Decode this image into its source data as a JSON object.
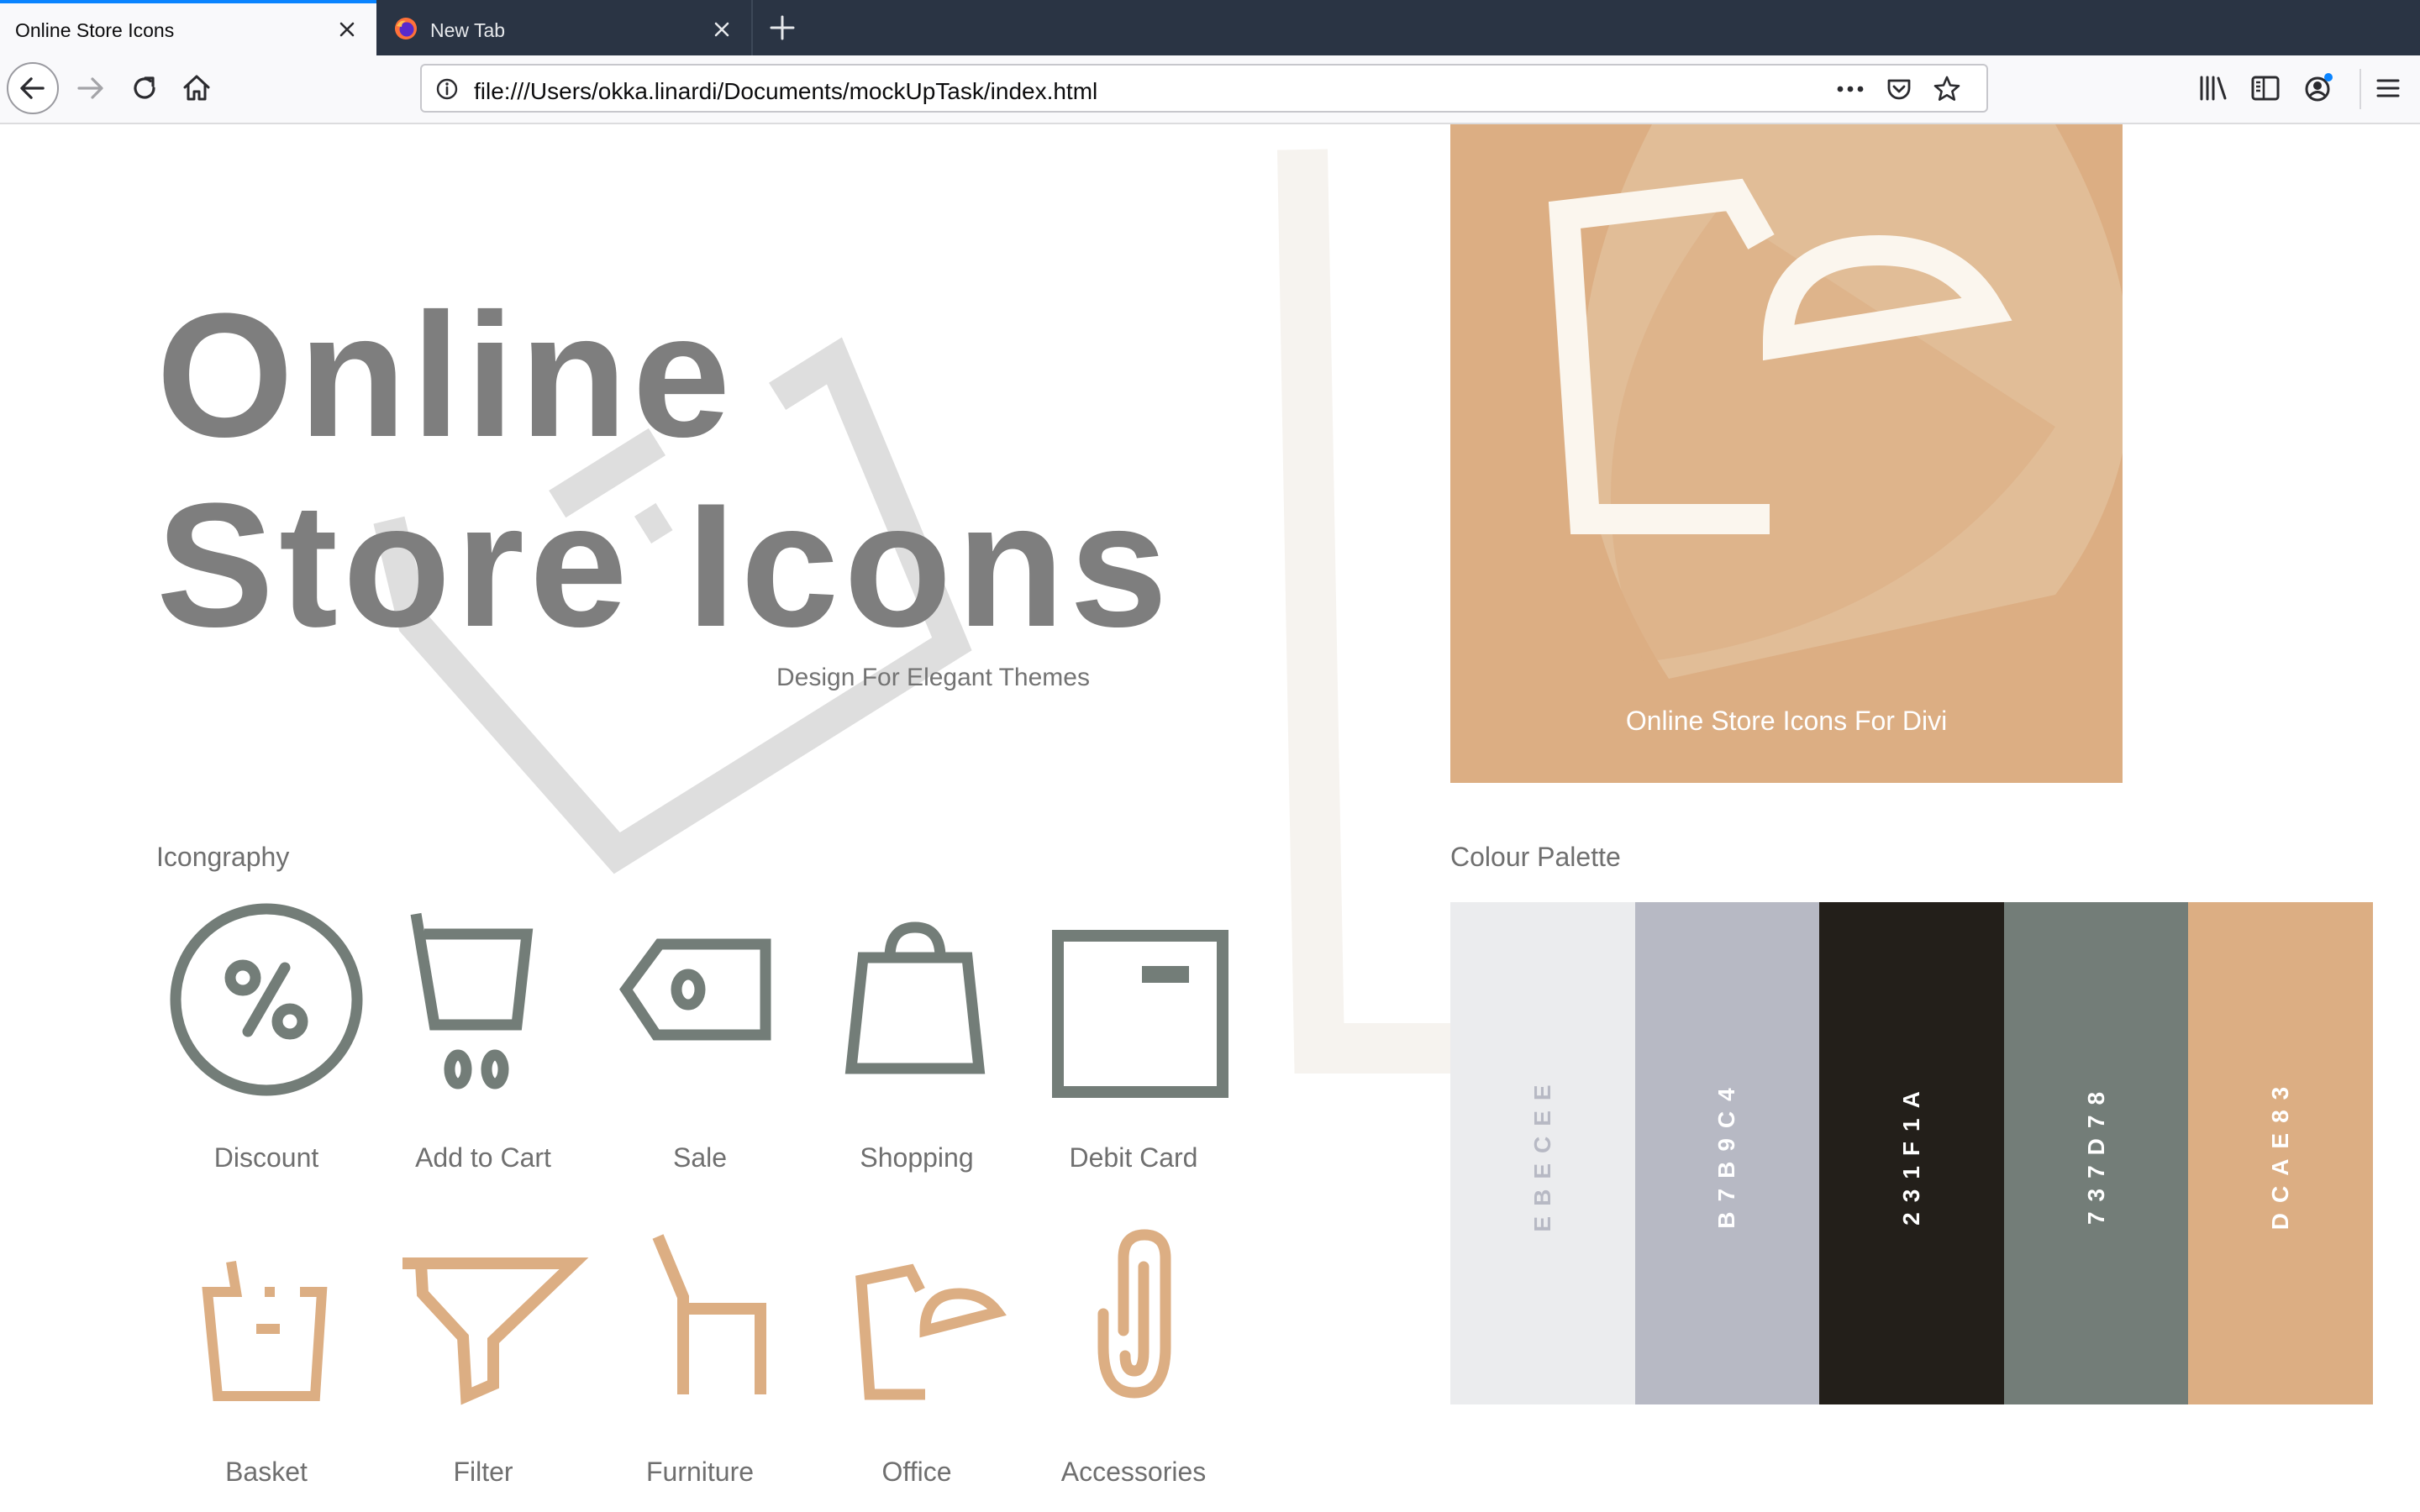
{
  "browser": {
    "tabs": [
      {
        "label": "Online Store Icons",
        "active": true
      },
      {
        "label": "New Tab",
        "active": false
      }
    ],
    "url": "file:///Users/okka.linardi/Documents/mockUpTask/index.html"
  },
  "hero": {
    "title_line1": "Online",
    "title_line2": "Store Icons",
    "subtitle": "Design For Elegant Themes"
  },
  "feature": {
    "caption": "Online Store Icons For Divi",
    "background": "#dcae83",
    "icon": "desk-lamp-icon"
  },
  "iconography": {
    "heading": "Icongraphy",
    "items": [
      {
        "label": "Discount",
        "icon": "discount-icon",
        "color": "#737d78"
      },
      {
        "label": "Add to Cart",
        "icon": "cart-icon",
        "color": "#737d78"
      },
      {
        "label": "Sale",
        "icon": "tag-icon",
        "color": "#737d78"
      },
      {
        "label": "Shopping",
        "icon": "shopping-bag-icon",
        "color": "#737d78"
      },
      {
        "label": "Debit Card",
        "icon": "card-icon",
        "color": "#737d78"
      },
      {
        "label": "Basket",
        "icon": "basket-icon",
        "color": "#dcae83"
      },
      {
        "label": "Filter",
        "icon": "filter-icon",
        "color": "#dcae83"
      },
      {
        "label": "Furniture",
        "icon": "chair-icon",
        "color": "#dcae83"
      },
      {
        "label": "Office",
        "icon": "lamp-icon",
        "color": "#dcae83"
      },
      {
        "label": "Accessories",
        "icon": "paperclip-icon",
        "color": "#dcae83"
      }
    ]
  },
  "palette": {
    "heading": "Colour Palette",
    "swatches": [
      {
        "code": "EBECEE",
        "color": "#ebecee",
        "text_color": "#b7b9c4"
      },
      {
        "code": "B7B9C4",
        "color": "#b7b9c4",
        "text_color": "#ffffff"
      },
      {
        "code": "231F1A",
        "color": "#231f1a",
        "text_color": "#ffffff"
      },
      {
        "code": "737D78",
        "color": "#737d78",
        "text_color": "#ffffff"
      },
      {
        "code": "DCAE83",
        "color": "#dcae83",
        "text_color": "#ffffff"
      }
    ]
  }
}
